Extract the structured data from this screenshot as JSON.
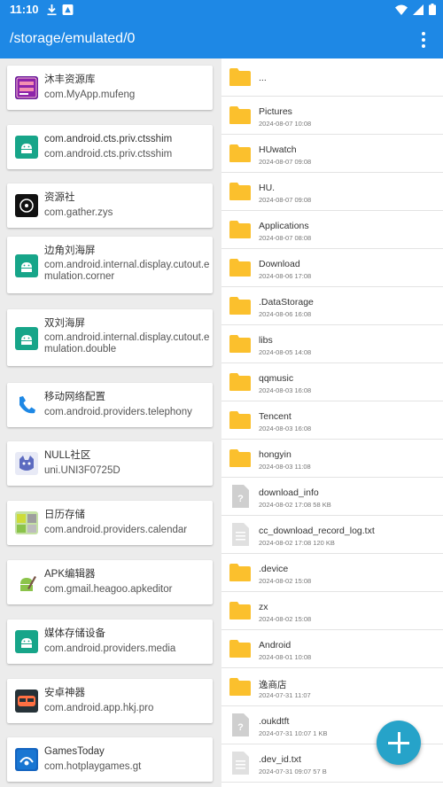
{
  "status_bar": {
    "time": "11:10"
  },
  "app_bar": {
    "path": "/storage/emulated/0"
  },
  "apps": [
    {
      "name": "沐丰资源库",
      "package": "com.MyApp.mufeng",
      "icon": "mufeng-app-icon"
    },
    {
      "name": "com.android.cts.priv.ctsshim",
      "package": "com.android.cts.priv.ctsshim",
      "icon": "android-icon"
    },
    {
      "name": "资源社",
      "package": "com.gather.zys",
      "icon": "ziyuanshe-app-icon"
    },
    {
      "name": "边角刘海屏",
      "package": "com.android.internal.display.cutout.emulation.corner",
      "icon": "android-icon"
    },
    {
      "name": "双刘海屏",
      "package": "com.android.internal.display.cutout.emulation.double",
      "icon": "android-icon"
    },
    {
      "name": "移动网络配置",
      "package": "com.android.providers.telephony",
      "icon": "phone-icon"
    },
    {
      "name": "NULL社区",
      "package": "uni.UNI3F0725D",
      "icon": "null-community-icon"
    },
    {
      "name": "日历存储",
      "package": "com.android.providers.calendar",
      "icon": "calendar-storage-icon"
    },
    {
      "name": "APK编辑器",
      "package": "com.gmail.heagoo.apkeditor",
      "icon": "apk-editor-icon"
    },
    {
      "name": "媒体存储设备",
      "package": "com.android.providers.media",
      "icon": "android-icon"
    },
    {
      "name": "安卓神器",
      "package": "com.android.app.hkj.pro",
      "icon": "anzhuo-shenqi-icon"
    },
    {
      "name": "GamesToday",
      "package": "com.hotplaygames.gt",
      "icon": "gamestoday-icon"
    }
  ],
  "files": [
    {
      "name": "...",
      "meta": "",
      "type": "folder"
    },
    {
      "name": "Pictures",
      "meta": "2024-08-07 10:08",
      "type": "folder"
    },
    {
      "name": "HUwatch",
      "meta": "2024-08-07 09:08",
      "type": "folder"
    },
    {
      "name": "HU.",
      "meta": "2024-08-07 09:08",
      "type": "folder"
    },
    {
      "name": "Applications",
      "meta": "2024-08-07 08:08",
      "type": "folder"
    },
    {
      "name": "Download",
      "meta": "2024-08-06 17:08",
      "type": "folder"
    },
    {
      "name": ".DataStorage",
      "meta": "2024-08-06 16:08",
      "type": "folder"
    },
    {
      "name": "libs",
      "meta": "2024-08-05 14:08",
      "type": "folder"
    },
    {
      "name": "qqmusic",
      "meta": "2024-08-03 16:08",
      "type": "folder"
    },
    {
      "name": "Tencent",
      "meta": "2024-08-03 16:08",
      "type": "folder"
    },
    {
      "name": "hongyin",
      "meta": "2024-08-03 11:08",
      "type": "folder"
    },
    {
      "name": "download_info",
      "meta": "2024-08-02 17:08 58 KB",
      "type": "unknown"
    },
    {
      "name": "cc_download_record_log.txt",
      "meta": "2024-08-02 17:08 120 KB",
      "type": "text"
    },
    {
      "name": ".device",
      "meta": "2024-08-02 15:08",
      "type": "folder"
    },
    {
      "name": "zx",
      "meta": "2024-08-02 15:08",
      "type": "folder"
    },
    {
      "name": "Android",
      "meta": "2024-08-01 10:08",
      "type": "folder"
    },
    {
      "name": "逸商店",
      "meta": "2024-07-31 11:07",
      "type": "folder"
    },
    {
      "name": ".oukdtft",
      "meta": "2024-07-31 10:07 1 KB",
      "type": "unknown"
    },
    {
      "name": ".dev_id.txt",
      "meta": "2024-07-31 09:07 57 B",
      "type": "text"
    }
  ],
  "colors": {
    "primary": "#1e88e5",
    "fab": "#26a3c9",
    "folder": "#fbc02d",
    "android_green": "#17a589"
  }
}
